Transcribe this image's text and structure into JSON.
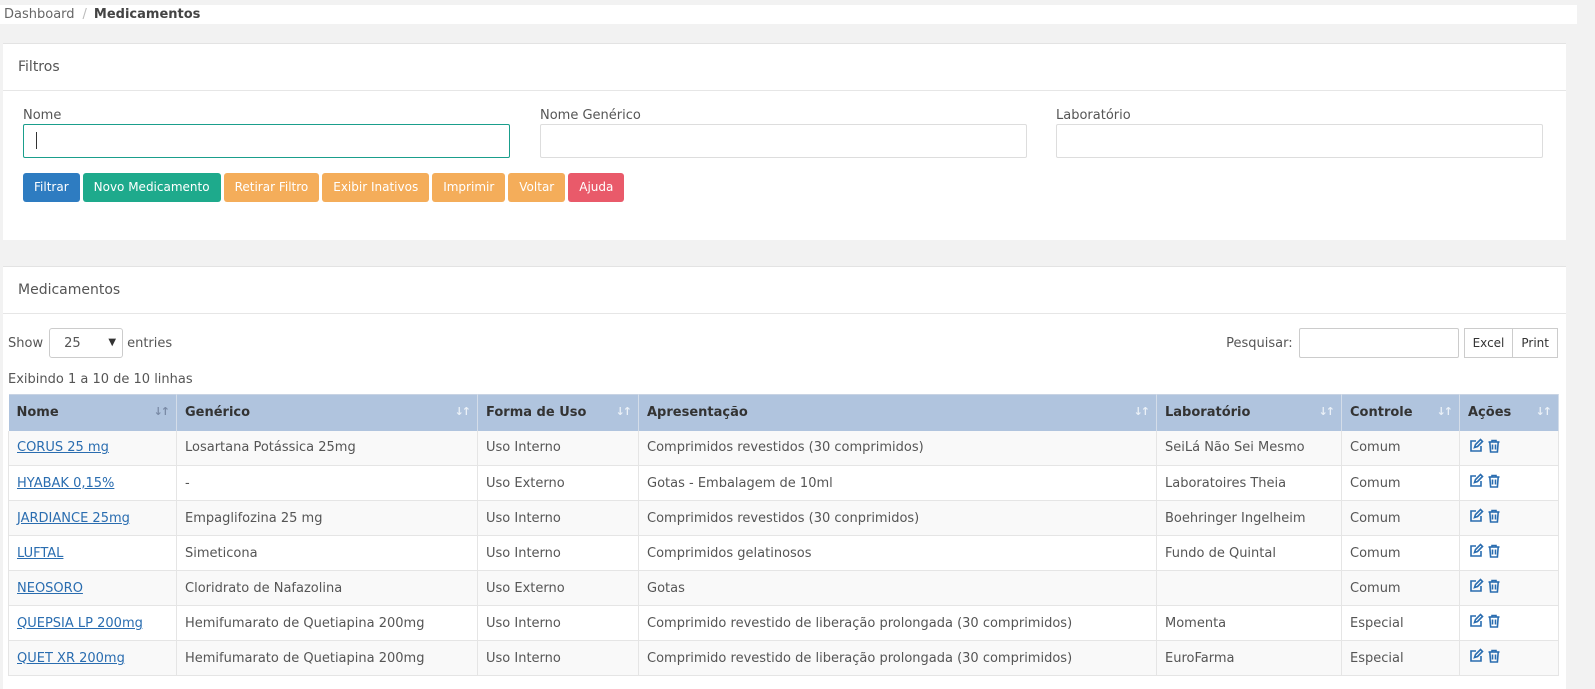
{
  "breadcrumb": {
    "home": "Dashboard",
    "separator": "/",
    "current": "Medicamentos"
  },
  "filters": {
    "title": "Filtros",
    "fields": {
      "nome": {
        "label": "Nome",
        "value": ""
      },
      "generico": {
        "label": "Nome Genérico",
        "value": ""
      },
      "laboratorio": {
        "label": "Laboratório",
        "value": ""
      }
    },
    "buttons": {
      "filtrar": "Filtrar",
      "novo": "Novo Medicamento",
      "retirar": "Retirar Filtro",
      "inativos": "Exibir Inativos",
      "imprimir": "Imprimir",
      "voltar": "Voltar",
      "ajuda": "Ajuda"
    }
  },
  "list": {
    "title": "Medicamentos",
    "show_label": "Show",
    "entries_value": "25",
    "entries_label": "entries",
    "search_label": "Pesquisar:",
    "search_value": "",
    "excel_label": "Excel",
    "print_label": "Print",
    "info": "Exibindo 1 a 10 de 10 linhas",
    "columns": [
      "Nome",
      "Genérico",
      "Forma de Uso",
      "Apresentação",
      "Laboratório",
      "Controle",
      "Ações"
    ],
    "rows": [
      {
        "nome": "CORUS 25 mg",
        "generico": "Losartana Potássica 25mg",
        "forma": "Uso Interno",
        "apresentacao": "Comprimidos revestidos (30 comprimidos)",
        "laboratorio": "SeiLá Não Sei Mesmo",
        "controle": "Comum"
      },
      {
        "nome": "HYABAK 0,15%",
        "generico": "-",
        "forma": "Uso Externo",
        "apresentacao": "Gotas - Embalagem de 10ml",
        "laboratorio": "Laboratoires Theia",
        "controle": "Comum"
      },
      {
        "nome": "JARDIANCE 25mg",
        "generico": "Empaglifozina 25 mg",
        "forma": "Uso Interno",
        "apresentacao": "Comprimidos revestidos (30 conprimidos)",
        "laboratorio": "Boehringer Ingelheim",
        "controle": "Comum"
      },
      {
        "nome": "LUFTAL",
        "generico": "Simeticona",
        "forma": "Uso Interno",
        "apresentacao": "Comprimidos gelatinosos",
        "laboratorio": "Fundo de Quintal",
        "controle": "Comum"
      },
      {
        "nome": "NEOSORO",
        "generico": "Cloridrato de Nafazolina",
        "forma": "Uso Externo",
        "apresentacao": "Gotas",
        "laboratorio": "",
        "controle": "Comum"
      },
      {
        "nome": "QUEPSIA LP 200mg",
        "generico": "Hemifumarato de Quetiapina 200mg",
        "forma": "Uso Interno",
        "apresentacao": "Comprimido revestido de liberação prolongada (30 comprimidos)",
        "laboratorio": "Momenta",
        "controle": "Especial"
      },
      {
        "nome": "QUET XR 200mg",
        "generico": "Hemifumarato de Quetiapina 200mg",
        "forma": "Uso Interno",
        "apresentacao": "Comprimido revestido de liberação prolongada (30 comprimidos)",
        "laboratorio": "EuroFarma",
        "controle": "Especial"
      }
    ]
  },
  "icons": {
    "edit": "edit-icon",
    "delete": "trash-icon",
    "sort": "sort-icon"
  },
  "colors": {
    "accent": "#1eaa8c",
    "primary": "#2e7cc1",
    "warning": "#f4ad5a",
    "danger": "#e95a6a",
    "table_header": "#b0c4de",
    "link": "#2a6db0"
  }
}
